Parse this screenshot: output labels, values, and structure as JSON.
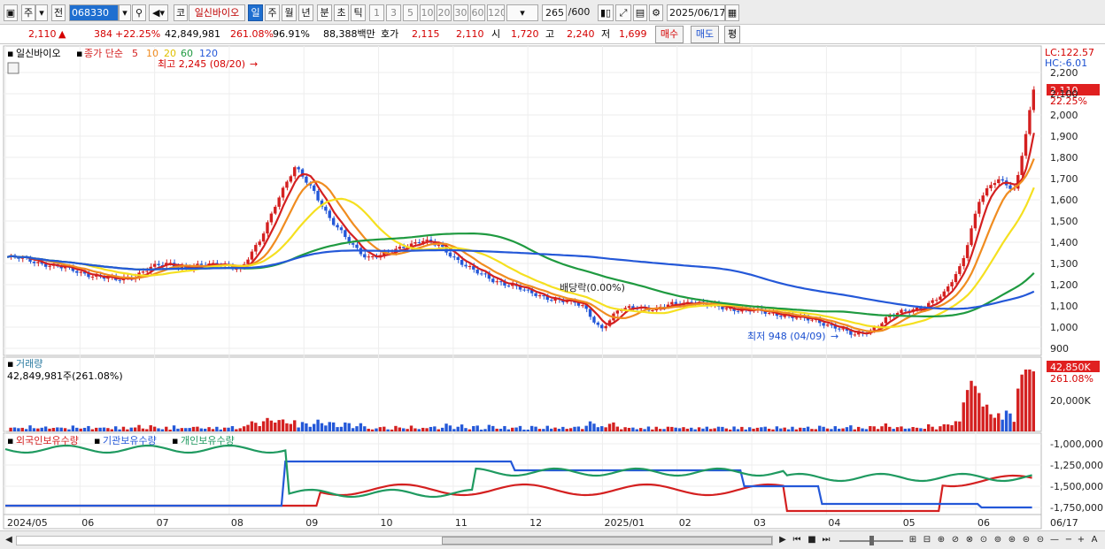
{
  "toolbar": {
    "period_mode": "주",
    "prev_label": "전",
    "code": "068330",
    "market_flag": "코",
    "stock_name": "일신바이오",
    "periods": [
      "일",
      "주",
      "월",
      "년",
      "분",
      "초",
      "틱"
    ],
    "active_period": "일",
    "intervals": [
      "1",
      "3",
      "5",
      "10",
      "20",
      "30",
      "60",
      "120"
    ],
    "count": "265",
    "max_count": "/600",
    "date": "2025/06/17"
  },
  "quote": {
    "price": "2,110",
    "arrow": "▲",
    "change": "384",
    "change_pct": "+22.25%",
    "volume": "42,849,981",
    "volume_ratio": "261.08%",
    "ratio2": "96.91%",
    "amount": "88,388백만",
    "ask_label": "호가",
    "ask1": "2,115",
    "ask2": "2,110",
    "open_label": "시",
    "open": "1,720",
    "high_label": "고",
    "high": "2,240",
    "low_label": "저",
    "low": "1,699",
    "buy_label": "매수",
    "sell_label": "매도",
    "flat_label": "평"
  },
  "price_panel": {
    "stock_label": "일신바이오",
    "legend_prefix": "종가 단순",
    "ma_periods": [
      "5",
      "10",
      "20",
      "60",
      "120"
    ],
    "ma_colors": [
      "#d42020",
      "#f08c20",
      "#f5e020",
      "#1f9a40",
      "#2458d8"
    ],
    "lc_label": "LC:122.57",
    "hc_label": "HC:-6.01",
    "current_price_badge": "2,110",
    "current_pct": "22.25%",
    "high_annotation": "최고 2,245 (08/20)",
    "low_annotation": "최저 948 (04/09)",
    "dividend_annotation": "배당락(0.00%)",
    "y_ticks": [
      "2,200",
      "2,100",
      "2,000",
      "1,900",
      "1,800",
      "1,700",
      "1,600",
      "1,500",
      "1,400",
      "1,300",
      "1,200",
      "1,100",
      "1,000",
      "900"
    ]
  },
  "volume_panel": {
    "title": "거래량",
    "value_label": "42,849,981주(261.08%)",
    "badge": "42,850K",
    "badge_pct": "261.08%",
    "y_tick": "20,000K"
  },
  "holdings_panel": {
    "legend": [
      {
        "name": "외국인보유수량",
        "color": "#d42020"
      },
      {
        "name": "기관보유수량",
        "color": "#2458d8"
      },
      {
        "name": "개인보유수량",
        "color": "#1f9a60"
      }
    ],
    "y_ticks": [
      "-1,000,000",
      "-1,250,000",
      "-1,500,000",
      "-1,750,000"
    ]
  },
  "x_axis": {
    "labels": [
      "2024/05",
      "06",
      "07",
      "08",
      "09",
      "10",
      "11",
      "12",
      "2025/01",
      "02",
      "03",
      "04",
      "05",
      "06"
    ],
    "end_label": "06/17"
  },
  "chart_data": {
    "type": "candlestick",
    "x_start": "2024/05",
    "x_end": "2025/06/17",
    "ylim": [
      900,
      2250
    ],
    "close_series_approx": [
      1330,
      1320,
      1300,
      1280,
      1260,
      1240,
      1220,
      1240,
      1280,
      1300,
      1280,
      1290,
      1300,
      1270,
      1400,
      1600,
      1750,
      1650,
      1500,
      1400,
      1330,
      1340,
      1380,
      1410,
      1380,
      1320,
      1260,
      1220,
      1200,
      1160,
      1140,
      1120,
      1100,
      990,
      1080,
      1100,
      1080,
      1110,
      1120,
      1100,
      1090,
      1080,
      1070,
      1060,
      1040,
      1030,
      1000,
      960,
      990,
      1050,
      1080,
      1100,
      1150,
      1300,
      1600,
      1700,
      1650,
      2110
    ],
    "high": {
      "value": 2245,
      "date": "08/20"
    },
    "low": {
      "value": 948,
      "date": "04/09"
    }
  }
}
